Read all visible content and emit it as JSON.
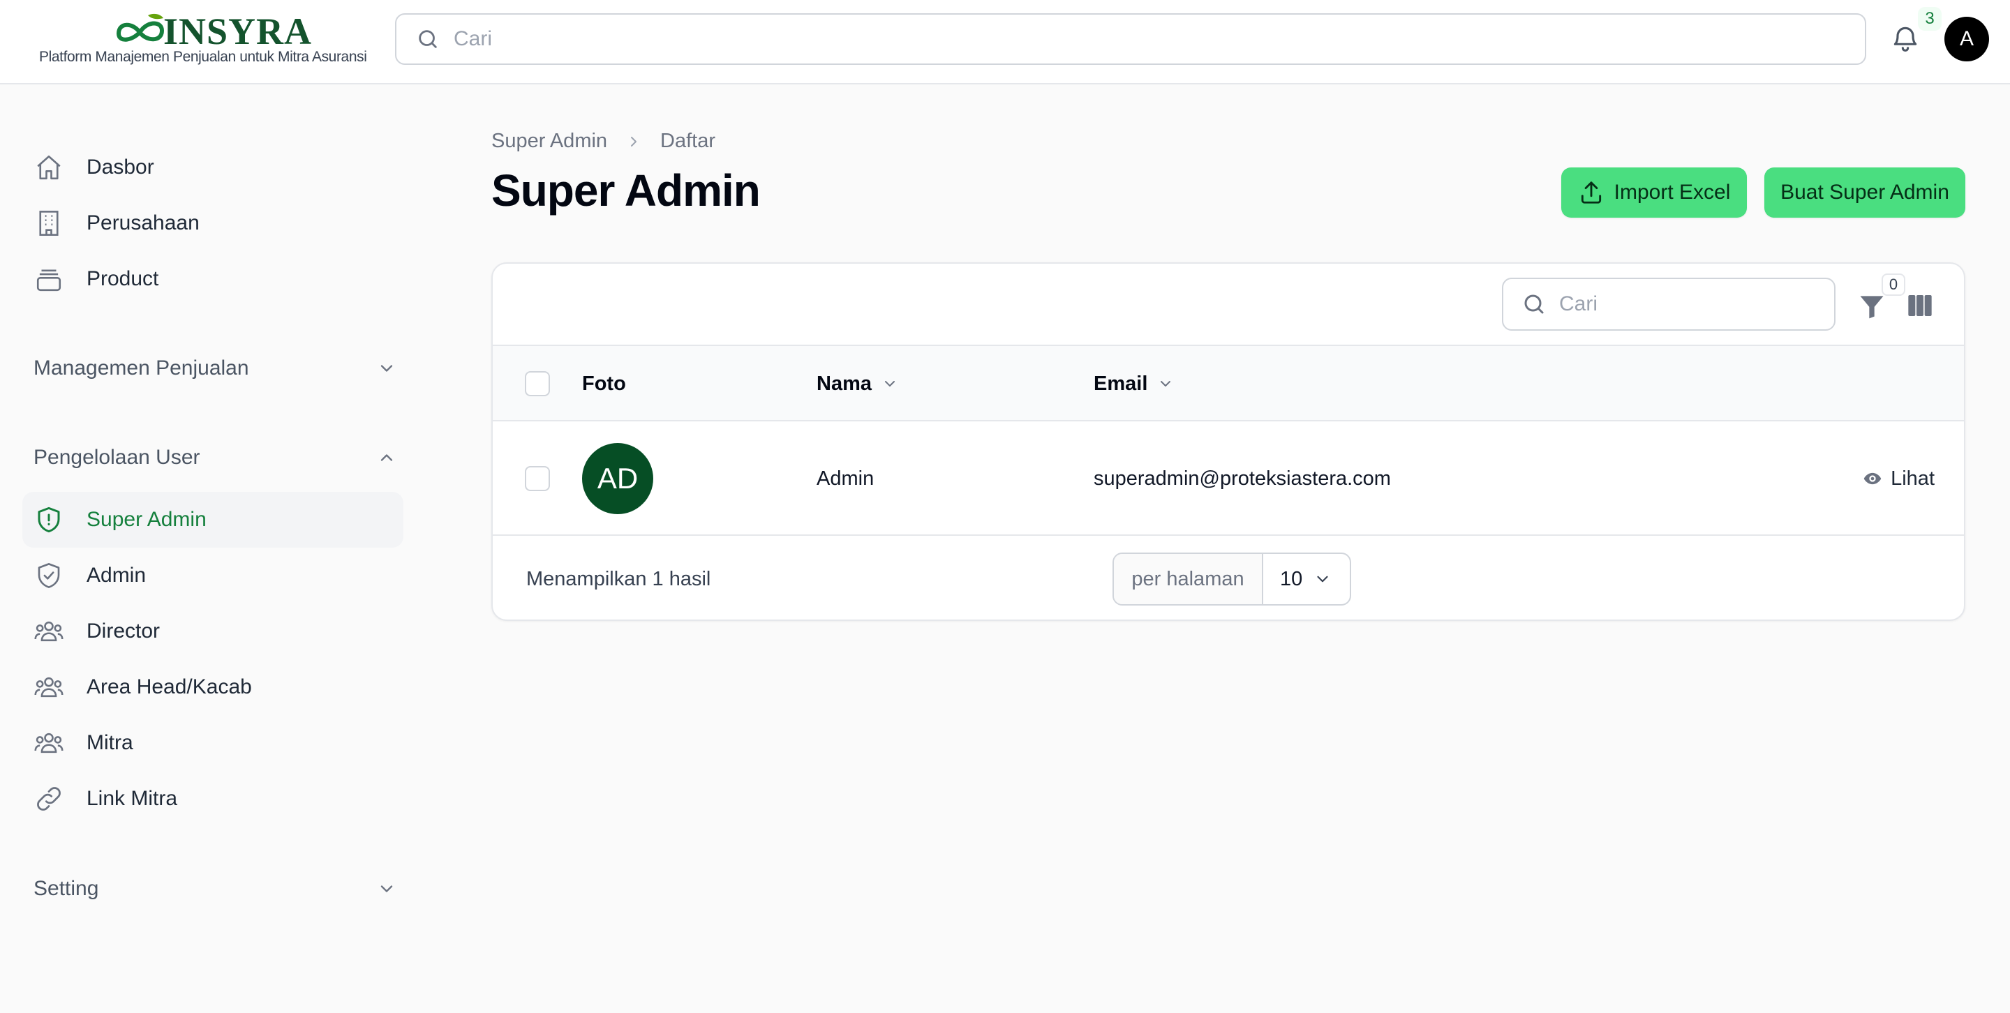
{
  "brand": {
    "name": "INSYRA",
    "tagline": "Platform Manajemen Penjualan untuk Mitra Asuransi",
    "color": "#14532d"
  },
  "topbar": {
    "search_placeholder": "Cari",
    "notification_count": "3",
    "user_initial": "A"
  },
  "sidebar": {
    "top_items": [
      {
        "label": "Dasbor",
        "icon": "home-icon"
      },
      {
        "label": "Perusahaan",
        "icon": "building-icon"
      },
      {
        "label": "Product",
        "icon": "box-icon"
      }
    ],
    "groups": {
      "sales": {
        "label": "Managemen Penjualan",
        "expanded": false
      },
      "users": {
        "label": "Pengelolaan User",
        "expanded": true
      },
      "setting": {
        "label": "Setting",
        "expanded": false
      }
    },
    "user_items": [
      {
        "label": "Super Admin",
        "icon": "shield-exclamation-icon",
        "active": true
      },
      {
        "label": "Admin",
        "icon": "shield-check-icon",
        "active": false
      },
      {
        "label": "Director",
        "icon": "user-group-icon",
        "active": false
      },
      {
        "label": "Area Head/Kacab",
        "icon": "user-group-icon",
        "active": false
      },
      {
        "label": "Mitra",
        "icon": "user-group-icon",
        "active": false
      },
      {
        "label": "Link Mitra",
        "icon": "link-icon",
        "active": false
      }
    ]
  },
  "breadcrumb": {
    "parent": "Super Admin",
    "current": "Daftar"
  },
  "page": {
    "title": "Super Admin",
    "import_label": "Import Excel",
    "create_label": "Buat Super Admin",
    "accent_color": "#4ade80"
  },
  "table": {
    "search_placeholder": "Cari",
    "filter_count": "0",
    "columns": {
      "photo": "Foto",
      "name": "Nama",
      "email": "Email"
    },
    "rows": [
      {
        "initials": "AD",
        "name": "Admin",
        "email": "superadmin@proteksiastera.com",
        "action": "Lihat"
      }
    ],
    "footer": {
      "result_text": "Menampilkan 1 hasil",
      "per_page_label": "per halaman",
      "per_page_value": "10"
    }
  }
}
